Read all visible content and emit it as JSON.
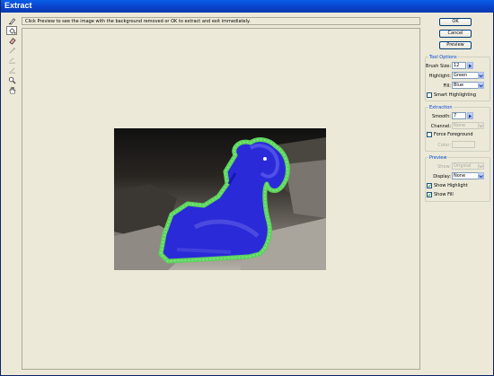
{
  "window": {
    "title": "Extract"
  },
  "hint": "Click Preview to see the image with the background removed or OK to extract and exit immediately.",
  "tools": [
    {
      "icon": "edge-highlighter-icon",
      "active": false,
      "disabled": false
    },
    {
      "icon": "fill-tool-icon",
      "active": true,
      "disabled": false
    },
    {
      "icon": "eraser-icon",
      "active": false,
      "disabled": false
    },
    {
      "icon": "eyedropper-icon",
      "active": false,
      "disabled": true
    },
    {
      "icon": "cleanup-tool-icon",
      "active": false,
      "disabled": true
    },
    {
      "icon": "edge-touchup-icon",
      "active": false,
      "disabled": true
    },
    {
      "icon": "zoom-icon",
      "active": false,
      "disabled": false
    },
    {
      "icon": "hand-icon",
      "active": false,
      "disabled": false
    }
  ],
  "buttons": {
    "ok": "OK",
    "cancel": "Cancel",
    "preview": "Preview"
  },
  "tool_options": {
    "title": "Tool Options",
    "brush_size_label": "Brush Size:",
    "brush_size_value": "12",
    "highlight_label": "Highlight:",
    "highlight_value": "Green",
    "fill_label": "Fill:",
    "fill_value": "Blue",
    "smart_highlighting_label": "Smart Highlighting",
    "smart_highlighting_checked": false
  },
  "extraction": {
    "title": "Extraction",
    "smooth_label": "Smooth:",
    "smooth_value": "7",
    "channel_label": "Channel:",
    "channel_value": "None",
    "force_foreground_label": "Force Foreground",
    "force_foreground_checked": false,
    "color_label": "Color:"
  },
  "preview": {
    "title": "Preview",
    "show_label": "Show:",
    "show_value": "Original",
    "display_label": "Display:",
    "display_value": "None",
    "show_highlight_label": "Show Highlight",
    "show_highlight_checked": true,
    "show_fill_label": "Show Fill",
    "show_fill_checked": true
  },
  "colors": {
    "highlight": "#5cd45c",
    "fill": "#2a2ad8",
    "titlebar": "#0840c8",
    "group_title": "#0046d5"
  }
}
